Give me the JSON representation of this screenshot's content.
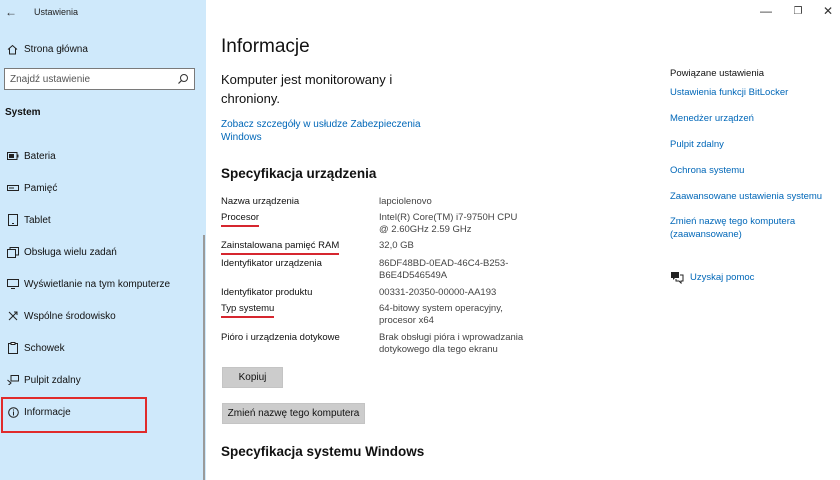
{
  "window": {
    "title": "Ustawienia",
    "controls": {
      "minimize": "—",
      "maximize": "❐",
      "close": "✕"
    }
  },
  "sidebar": {
    "back_icon": "back-arrow-icon",
    "home": {
      "label": "Strona główna",
      "icon": "home-icon"
    },
    "search": {
      "placeholder": "Znajdź ustawienie",
      "icon": "search-icon"
    },
    "section": "System",
    "items": [
      {
        "label": "Bateria",
        "icon": "battery-icon"
      },
      {
        "label": "Pamięć",
        "icon": "storage-icon"
      },
      {
        "label": "Tablet",
        "icon": "tablet-icon"
      },
      {
        "label": "Obsługa wielu zadań",
        "icon": "multitasking-icon"
      },
      {
        "label": "Wyświetlanie na tym komputerze",
        "icon": "projecting-icon"
      },
      {
        "label": "Wspólne środowisko",
        "icon": "shared-experiences-icon"
      },
      {
        "label": "Schowek",
        "icon": "clipboard-icon"
      },
      {
        "label": "Pulpit zdalny",
        "icon": "remote-desktop-icon"
      },
      {
        "label": "Informacje",
        "icon": "info-icon"
      }
    ]
  },
  "main": {
    "title": "Informacje",
    "monitor_text": "Komputer jest monitorowany i chroniony.",
    "security_link": "Zobacz szczegóły w usłudze Zabezpieczenia Windows",
    "spec_title": "Specyfikacja urządzenia",
    "specs": [
      {
        "label": "Nazwa urządzenia",
        "value": "lapciolenovo"
      },
      {
        "label": "Procesor",
        "value": "Intel(R) Core(TM) i7-9750H CPU @ 2.60GHz   2.59 GHz"
      },
      {
        "label": "Zainstalowana pamięć RAM",
        "value": "32,0 GB"
      },
      {
        "label": "Identyfikator urządzenia",
        "value": "86DF48BD-0EAD-46C4-B253-B6E4D546549A"
      },
      {
        "label": "Identyfikator produktu",
        "value": "00331-20350-00000-AA193"
      },
      {
        "label": "Typ systemu",
        "value": "64-bitowy system operacyjny, procesor x64"
      },
      {
        "label": "Pióro i urządzenia dotykowe",
        "value": "Brak obsługi pióra i wprowadzania dotykowego dla tego ekranu"
      }
    ],
    "copy_button": "Kopiuj",
    "rename_button": "Zmień nazwę tego komputera",
    "windows_spec_title": "Specyfikacja systemu Windows"
  },
  "related": {
    "title": "Powiązane ustawienia",
    "links": [
      "Ustawienia funkcji BitLocker",
      "Menedżer urządzeń",
      "Pulpit zdalny",
      "Ochrona systemu",
      "Zaawansowane ustawienia systemu",
      "Zmień nazwę tego komputera (zaawansowane)"
    ],
    "help": {
      "label": "Uzyskaj pomoc",
      "icon": "help-chat-icon"
    }
  }
}
